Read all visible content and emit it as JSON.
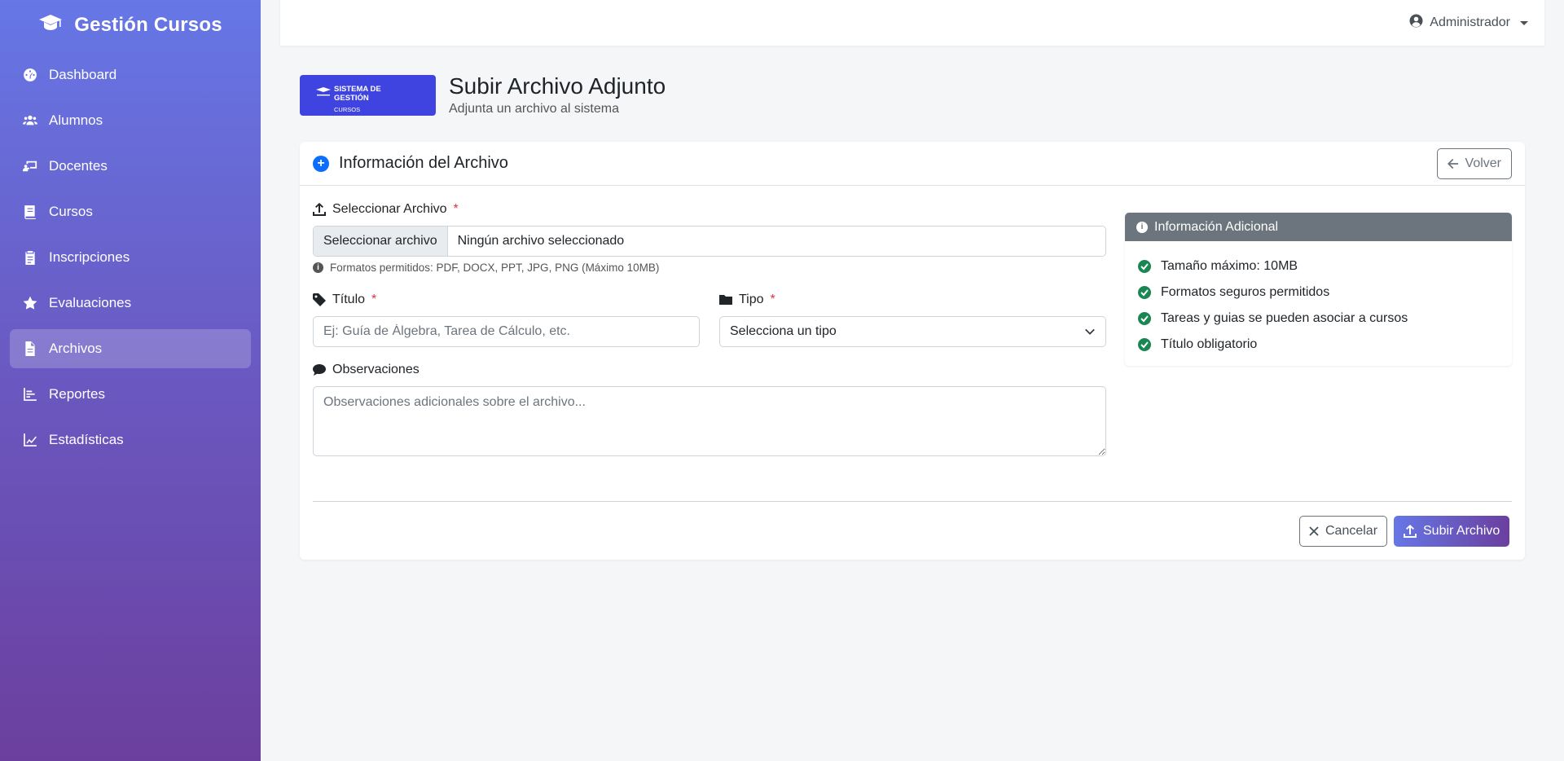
{
  "brand": {
    "name": "Gestión Cursos"
  },
  "sidebar": {
    "items": [
      {
        "label": "Dashboard",
        "icon": "dashboard-icon"
      },
      {
        "label": "Alumnos",
        "icon": "users-icon"
      },
      {
        "label": "Docentes",
        "icon": "teacher-icon"
      },
      {
        "label": "Cursos",
        "icon": "book-icon"
      },
      {
        "label": "Inscripciones",
        "icon": "clipboard-icon"
      },
      {
        "label": "Evaluaciones",
        "icon": "star-icon"
      },
      {
        "label": "Archivos",
        "icon": "file-icon",
        "active": true
      },
      {
        "label": "Reportes",
        "icon": "bar-chart-icon"
      },
      {
        "label": "Estadísticas",
        "icon": "line-chart-icon"
      }
    ]
  },
  "topbar": {
    "user": "Administrador"
  },
  "logo": {
    "line1": "SISTEMA DE GESTIÓN",
    "line2": "CURSOS"
  },
  "page": {
    "title": "Subir Archivo Adjunto",
    "subtitle": "Adjunta un archivo al sistema"
  },
  "card": {
    "title": "Información del Archivo",
    "back_label": "Volver"
  },
  "form": {
    "file": {
      "label": "Seleccionar Archivo",
      "button": "Seleccionar archivo",
      "value": "Ningún archivo seleccionado",
      "help": "Formatos permitidos: PDF, DOCX, PPT, JPG, PNG (Máximo 10MB)"
    },
    "title": {
      "label": "Título",
      "placeholder": "Ej: Guía de Álgebra, Tarea de Cálculo, etc."
    },
    "type": {
      "label": "Tipo",
      "selected": "Selecciona un tipo"
    },
    "notes": {
      "label": "Observaciones",
      "placeholder": "Observaciones adicionales sobre el archivo..."
    },
    "required_mark": "*"
  },
  "info": {
    "title": "Información Adicional",
    "items": [
      "Tamaño máximo: 10MB",
      "Formatos seguros permitidos",
      "Tareas y guias se pueden asociar a cursos",
      "Título obligatorio"
    ]
  },
  "actions": {
    "cancel": "Cancelar",
    "submit": "Subir Archivo"
  },
  "colors": {
    "primary": "#0d6efd",
    "success": "#198754",
    "danger": "#dc3545",
    "secondary": "#6c757d",
    "sidebar_top": "#6677e6",
    "sidebar_bottom": "#6b3f9e",
    "logo_bg": "#3f44e0"
  }
}
